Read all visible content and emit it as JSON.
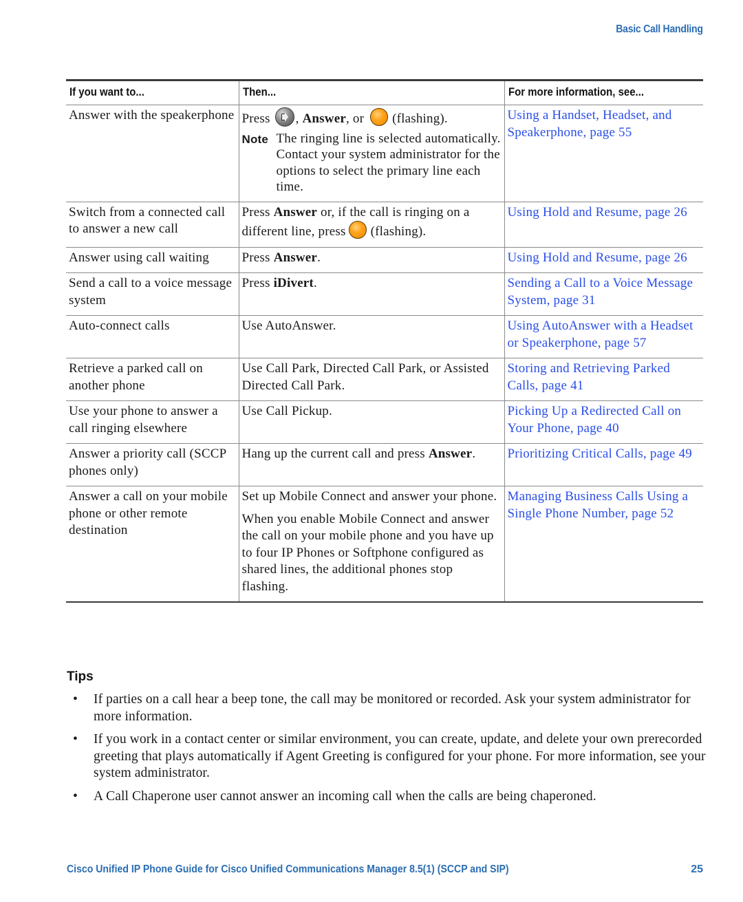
{
  "header": {
    "section_title": "Basic Call Handling"
  },
  "table": {
    "columns": [
      "If you want to...",
      "Then...",
      "For more information, see..."
    ],
    "rows": [
      {
        "want": "Answer with the speakerphone",
        "then_prefix": "Press",
        "then_icon1": "speaker-button-icon",
        "then_sep1": ",",
        "then_bold": "Answer",
        "then_sep2": ", or",
        "then_icon2": "line-button-icon",
        "then_suffix": "(flashing).",
        "note_label": "Note",
        "note_text": "The ringing line is selected automatically. Contact your system administrator for the options to select the primary line each time.",
        "see": "Using a Handset, Headset, and Speakerphone, page 55"
      },
      {
        "want": "Switch from a connected call to answer a new call",
        "then_prefix": "Press",
        "then_bold": "Answer",
        "then_mid": "or, if the call is ringing on a different line, press",
        "then_icon": "line-button-icon",
        "then_suffix": "(flashing).",
        "see": "Using Hold and Resume, page 26"
      },
      {
        "want": "Answer using call waiting",
        "then_prefix": "Press",
        "then_bold": "Answer",
        "then_suffix": ".",
        "see": "Using Hold and Resume, page 26"
      },
      {
        "want": "Send a call to a voice message system",
        "then_prefix": "Press",
        "then_bold": "iDivert",
        "then_suffix": ".",
        "see": "Sending a Call to a Voice Message System, page 31"
      },
      {
        "want": "Auto-connect calls",
        "then": "Use AutoAnswer.",
        "see": "Using AutoAnswer with a Headset or Speakerphone, page 57"
      },
      {
        "want": "Retrieve a parked call on another phone",
        "then": "Use Call Park, Directed Call Park, or Assisted Directed Call Park.",
        "see": "Storing and Retrieving Parked Calls, page 41"
      },
      {
        "want": "Use your phone to answer a call ringing elsewhere",
        "then": "Use Call Pickup.",
        "see": "Picking Up a Redirected Call on Your Phone, page 40"
      },
      {
        "want": "Answer a priority call (SCCP phones only)",
        "then_prefix": "Hang up the current call and press",
        "then_bold": "Answer",
        "then_suffix": ".",
        "see": "Prioritizing Critical Calls, page 49"
      },
      {
        "want": "Answer a call on your mobile phone or other remote destination",
        "then": "Set up Mobile Connect and answer your phone.",
        "then_para2": "When you enable Mobile Connect and answer the call on your mobile phone and you have up to four IP Phones or Softphone configured as shared lines, the additional phones stop flashing.",
        "see": "Managing Business Calls Using a Single Phone Number, page 52"
      }
    ]
  },
  "tips": {
    "heading": "Tips",
    "bullet": "•",
    "items": [
      "If parties on a call hear a beep tone, the call may be monitored or recorded. Ask your system administrator for more information.",
      "If you work in a contact center or similar environment, you can create, update, and delete your own prerecorded greeting that plays automatically if Agent Greeting is configured for your phone. For more information, see your system administrator.",
      "A Call Chaperone user cannot answer an incoming call when the calls are being chaperoned."
    ]
  },
  "footer": {
    "title": "Cisco Unified IP Phone Guide for Cisco Unified Communications Manager 8.5(1) (SCCP and SIP)",
    "page_number": "25"
  },
  "colors": {
    "brand_blue": "#2b6db3",
    "link_blue": "#2a4fe8",
    "line_button_orange": "#ffa31a"
  }
}
